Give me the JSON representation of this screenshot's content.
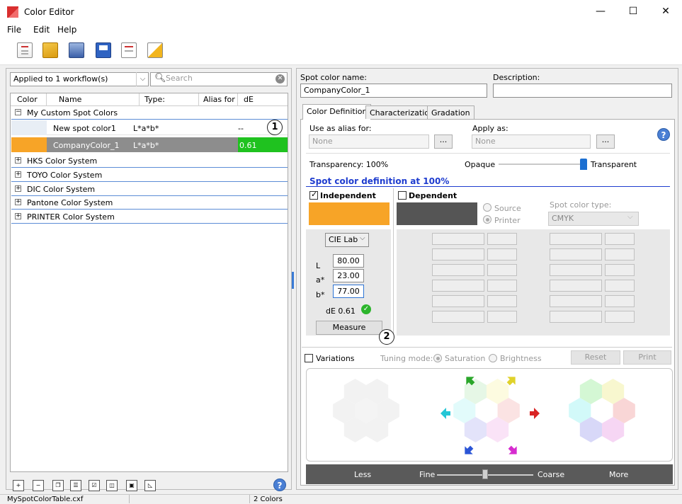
{
  "window": {
    "title": "Color Editor",
    "minimize": "—",
    "maximize": "☐",
    "close": "✕"
  },
  "menu": [
    "File",
    "Edit",
    "Help"
  ],
  "left": {
    "workflow_select": "Applied to 1 workflow(s)",
    "search_placeholder": "Search",
    "columns": [
      "Color",
      "Name",
      "Type:",
      "Alias for",
      "dE"
    ],
    "groups": [
      {
        "label": "My Custom Spot Colors",
        "expanded": true
      },
      {
        "label": "HKS Color System",
        "expanded": false
      },
      {
        "label": "TOYO Color System",
        "expanded": false
      },
      {
        "label": "DIC Color System",
        "expanded": false
      },
      {
        "label": "Pantone Color System",
        "expanded": false
      },
      {
        "label": "PRINTER Color System",
        "expanded": false
      }
    ],
    "rows": [
      {
        "name": "New spot color1",
        "type": "L*a*b*",
        "alias": "",
        "de": "--",
        "swatch": "#e8eef5"
      },
      {
        "name": "CompanyColor_1",
        "type": "L*a*b*",
        "alias": "",
        "de": "0.61",
        "swatch": "#f7a427",
        "de_color": "#1fc21f",
        "selected": true
      }
    ],
    "marker1": "1"
  },
  "right": {
    "spot_name_label": "Spot color name:",
    "spot_name_value": "CompanyColor_1",
    "description_label": "Description:",
    "description_value": "",
    "tabs": [
      "Color Definition",
      "Characterization",
      "Gradation"
    ],
    "alias_label": "Use as alias for:",
    "alias_value": "None",
    "apply_label": "Apply as:",
    "apply_value": "None",
    "ellipsis": "...",
    "transparency_label": "Transparency: 100%",
    "opaque_label": "Opaque",
    "transparent_label": "Transparent",
    "transparency_level": 1.0,
    "definition_heading": "Spot color definition at 100%",
    "independent_label": "Independent",
    "dependent_label": "Dependent",
    "source_label": "Source",
    "printer_label": "Printer",
    "spot_type_label": "Spot color type:",
    "spot_type_value": "CMYK",
    "colorspace": "CIE Lab",
    "l_label": "L",
    "a_label": "a*",
    "b_label": "b*",
    "l_value": "80.00",
    "a_value": "23.00",
    "b_value": "77.00",
    "de_text": "dE 0.61",
    "measure_label": "Measure",
    "marker2": "2",
    "independent_color": "#f7a427",
    "dependent_color": "#555555",
    "variations_label": "Variations",
    "tuning_label": "Tuning mode:",
    "saturation_label": "Saturation",
    "brightness_label": "Brightness",
    "reset_label": "Reset",
    "print_label": "Print",
    "less_label": "Less",
    "fine_label": "Fine",
    "coarse_label": "Coarse",
    "more_label": "More",
    "tuning_level": 0.5
  },
  "status": {
    "file": "MySpotColorTable.cxf",
    "count": "2 Colors"
  },
  "colors": {
    "accent_heading": "#1e3ccf",
    "selection": "#8d8d8d",
    "group_line": "#5c8dd6"
  }
}
